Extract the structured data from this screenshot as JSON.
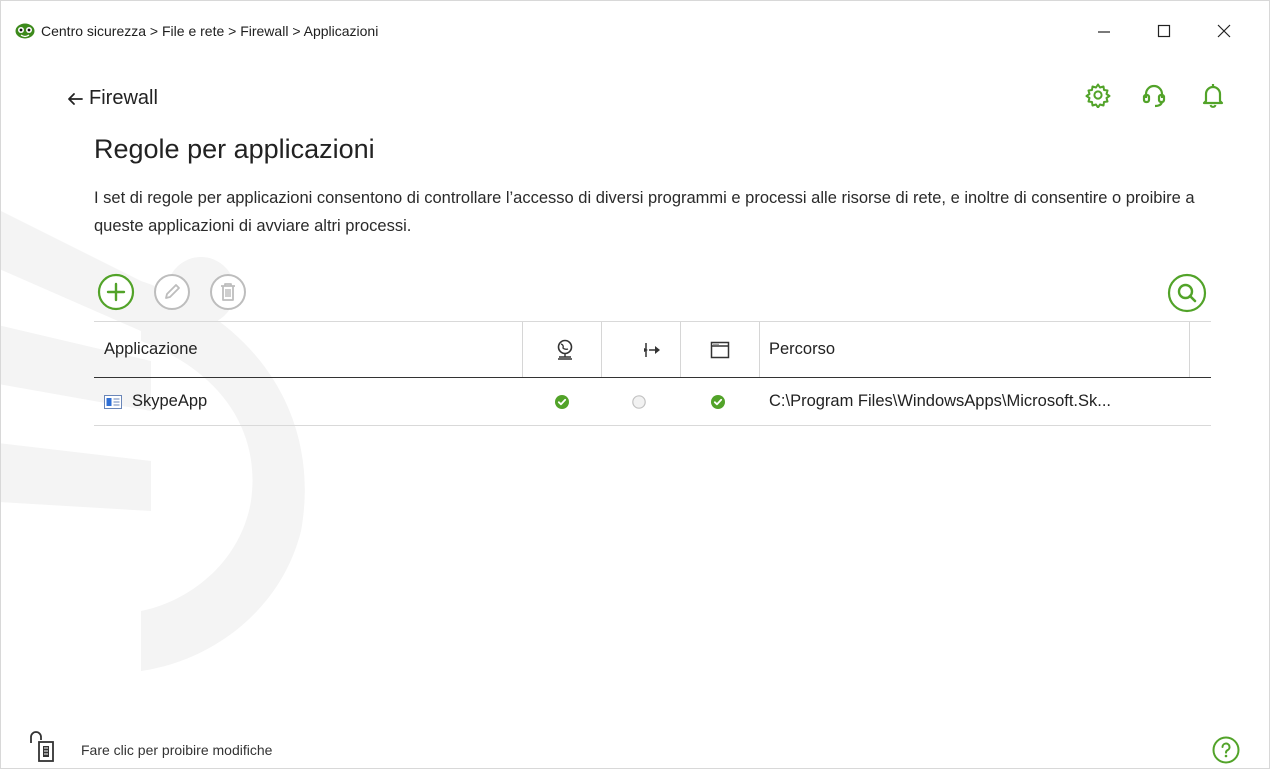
{
  "window": {
    "title": "Centro sicurezza > File e rete > Firewall > Applicazioni"
  },
  "nav": {
    "back_label": "Firewall"
  },
  "header_icons": [
    "gear-icon",
    "support-headset-icon",
    "bell-icon"
  ],
  "page": {
    "title": "Regole per applicazioni",
    "description": "I set di regole per applicazioni consentono di controllare l’accesso di diversi programmi e processi alle risorse di rete, e inoltre di consentire o proibire a queste applicazioni di avviare altri processi."
  },
  "toolbar": {
    "buttons": [
      "add-icon",
      "edit-icon",
      "delete-icon"
    ],
    "search_icon": "search-icon"
  },
  "table": {
    "columns": {
      "application": "Applicazione",
      "network_icon": "network-access-icon",
      "process_icon": "process-launch-icon",
      "window_icon": "window-icon",
      "path": "Percorso"
    },
    "rows": [
      {
        "app": "SkypeApp",
        "network": "allowed",
        "process": "not-set",
        "window": "allowed",
        "path": "C:\\Program Files\\WindowsApps\\Microsoft.Sk..."
      }
    ]
  },
  "footer": {
    "lock_text": "Fare clic per proibire modifiche"
  },
  "colors": {
    "accent": "#52a329",
    "disabled": "#b9b9b9",
    "text": "#222222"
  }
}
